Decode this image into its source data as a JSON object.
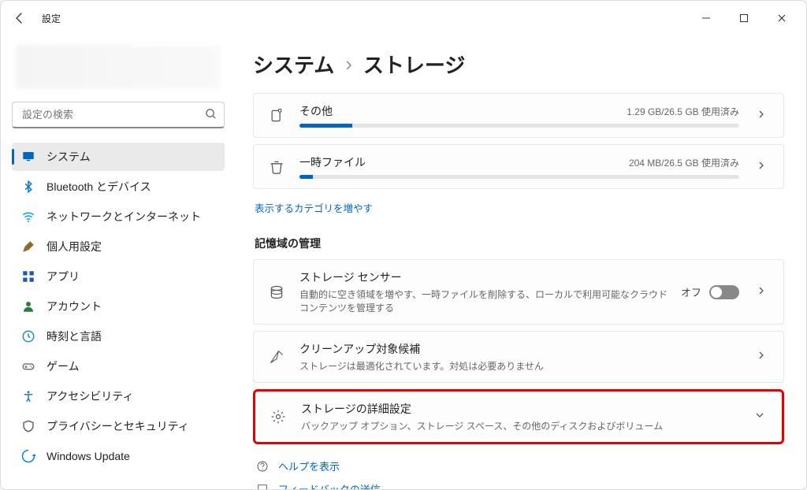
{
  "titlebar": {
    "app": "設定"
  },
  "search": {
    "placeholder": "設定の検索"
  },
  "sidebar": {
    "items": [
      {
        "label": "システム",
        "icon": "display",
        "active": true,
        "color": "#0067c0"
      },
      {
        "label": "Bluetooth とデバイス",
        "icon": "bluetooth",
        "color": "#0078d4"
      },
      {
        "label": "ネットワークとインターネット",
        "icon": "wifi",
        "color": "#00a4ef"
      },
      {
        "label": "個人用設定",
        "icon": "brush",
        "color": "#8a6a2f"
      },
      {
        "label": "アプリ",
        "icon": "apps",
        "color": "#1f5aa8"
      },
      {
        "label": "アカウント",
        "icon": "person",
        "color": "#2f7a3e"
      },
      {
        "label": "時刻と言語",
        "icon": "clock",
        "color": "#1f8fbf"
      },
      {
        "label": "ゲーム",
        "icon": "gamepad",
        "color": "#777"
      },
      {
        "label": "アクセシビリティ",
        "icon": "accessibility",
        "color": "#1f7ad0"
      },
      {
        "label": "プライバシーとセキュリティ",
        "icon": "shield",
        "color": "#666"
      },
      {
        "label": "Windows Update",
        "icon": "update",
        "color": "#0a84d0"
      }
    ]
  },
  "breadcrumbs": {
    "parent": "システム",
    "current": "ストレージ"
  },
  "categories": [
    {
      "title": "その他",
      "meta": "1.29 GB/26.5 GB 使用済み",
      "percent": 12
    },
    {
      "title": "一時ファイル",
      "meta": "204 MB/26.5 GB 使用済み",
      "percent": 3
    }
  ],
  "showMore": "表示するカテゴリを増やす",
  "manageHeader": "記憶域の管理",
  "cards": {
    "sense": {
      "title": "ストレージ センサー",
      "sub": "自動的に空き領域を増やす、一時ファイルを削除する、ローカルで利用可能なクラウド コンテンツを管理する",
      "toggle": "オフ"
    },
    "cleanup": {
      "title": "クリーンアップ対象候補",
      "sub": "ストレージは最適化されています。対処は必要ありません"
    },
    "advanced": {
      "title": "ストレージの詳細設定",
      "sub": "バックアップ オプション、ストレージ スペース、その他のディスクおよびボリューム"
    }
  },
  "footer": {
    "help": "ヘルプを表示",
    "feedback": "フィードバックの送信"
  }
}
